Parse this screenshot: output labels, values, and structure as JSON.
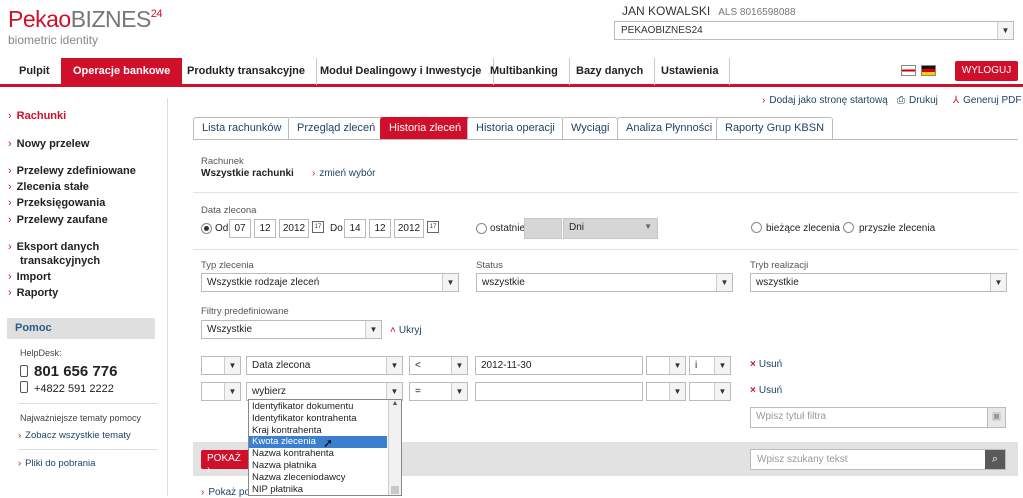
{
  "brand": {
    "logo_main_a": "Pekao",
    "logo_main_b": "BIZNES",
    "logo_sup": "24",
    "logo_sub": "biometric identity"
  },
  "user": {
    "name": "JAN KOWALSKI",
    "als": "ALS 8016598088",
    "context": "PEKAOBIZNES24"
  },
  "nav": {
    "items": [
      "Pulpit",
      "Operacje bankowe",
      "Produkty transakcyjne",
      "Moduł Dealingowy i Inwestycje",
      "Multibanking",
      "Bazy danych",
      "Ustawienia"
    ],
    "logout": "WYLOGUJ"
  },
  "toplinks": {
    "start": "Dodaj jako stronę startową",
    "print": "Drukuj",
    "pdf": "Generuj PDF"
  },
  "sidebar": {
    "items": [
      "Rachunki",
      "Nowy przelew",
      "Przelewy zdefiniowane",
      "Zlecenia stałe",
      "Przeksięgowania",
      "Przelewy zaufane",
      "Eksport danych",
      "transakcyjnych",
      "Import",
      "Raporty"
    ],
    "help_title": "Pomoc",
    "helpdesk_label": "HelpDesk:",
    "phone1": "801 656 776",
    "phone2": "+4822 591 2222",
    "topics_label": "Najważniejsze tematy pomocy",
    "topics_link": "Zobacz wszystkie tematy",
    "downloads_link": "Pliki do pobrania"
  },
  "tabs": [
    "Lista rachunków",
    "Przegląd zleceń",
    "Historia zleceń",
    "Historia operacji",
    "Wyciągi",
    "Analiza Płynności",
    "Raporty Grup KBSN"
  ],
  "account": {
    "label": "Rachunek",
    "value": "Wszystkie rachunki",
    "change": "zmień wybór"
  },
  "date": {
    "label": "Data zlecona",
    "from_label": "Od",
    "from_d": "07",
    "from_m": "12",
    "from_y": "2012",
    "to_label": "Do",
    "to_d": "14",
    "to_m": "12",
    "to_y": "2012",
    "last_label": "ostatnie",
    "unit": "Dni",
    "current": "bieżące zlecenia",
    "future": "przyszłe zlecenia"
  },
  "filters": {
    "type_label": "Typ zlecenia",
    "type_value": "Wszystkie rodzaje zleceń",
    "status_label": "Status",
    "status_value": "wszystkie",
    "mode_label": "Tryb realizacji",
    "mode_value": "wszystkie",
    "predef_label": "Filtry predefiniowane",
    "predef_value": "Wszystkie",
    "hide": "Ukryj"
  },
  "rows": [
    {
      "field": "Data zlecona",
      "op": "<",
      "value": "2012-11-30",
      "join": "i",
      "remove": "Usuń"
    },
    {
      "field": "wybierz",
      "op": "=",
      "value": "",
      "join": "",
      "remove": "Usuń"
    }
  ],
  "dropdown_options": [
    "Identyfikator dokumentu",
    "Identyfikator kontrahenta",
    "Kraj kontrahenta",
    "Kwota zlecenia",
    "Nazwa kontrahenta",
    "Nazwa płatnika",
    "Nazwa zleceniodawcy",
    "NIP płatnika"
  ],
  "filter_title_placeholder": "Wpisz tytuł filtra",
  "show_button": "POKAŻ",
  "search_placeholder": "Wpisz szukany tekst",
  "bottom_link": "Pokaż po",
  "colors": {
    "accent": "#d0102a",
    "link": "#224466"
  }
}
